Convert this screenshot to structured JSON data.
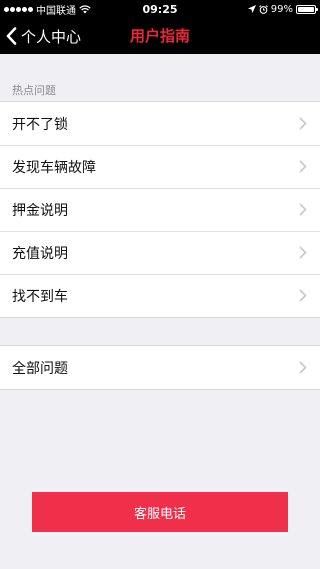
{
  "status_bar": {
    "carrier": "中国联通",
    "time": "09:25",
    "battery_percent": "99%",
    "battery_level": 0.99,
    "signal_bars": 5
  },
  "nav": {
    "back_label": "个人中心",
    "title": "用户指南",
    "title_color": "#e8283a"
  },
  "hot_section": {
    "header": "热点问题",
    "items": [
      {
        "label": "开不了锁"
      },
      {
        "label": "发现车辆故障"
      },
      {
        "label": "押金说明"
      },
      {
        "label": "充值说明"
      },
      {
        "label": "找不到车"
      }
    ]
  },
  "all_section": {
    "items": [
      {
        "label": "全部问题"
      }
    ]
  },
  "service_button": {
    "label": "客服电话",
    "color": "#f0304a"
  }
}
